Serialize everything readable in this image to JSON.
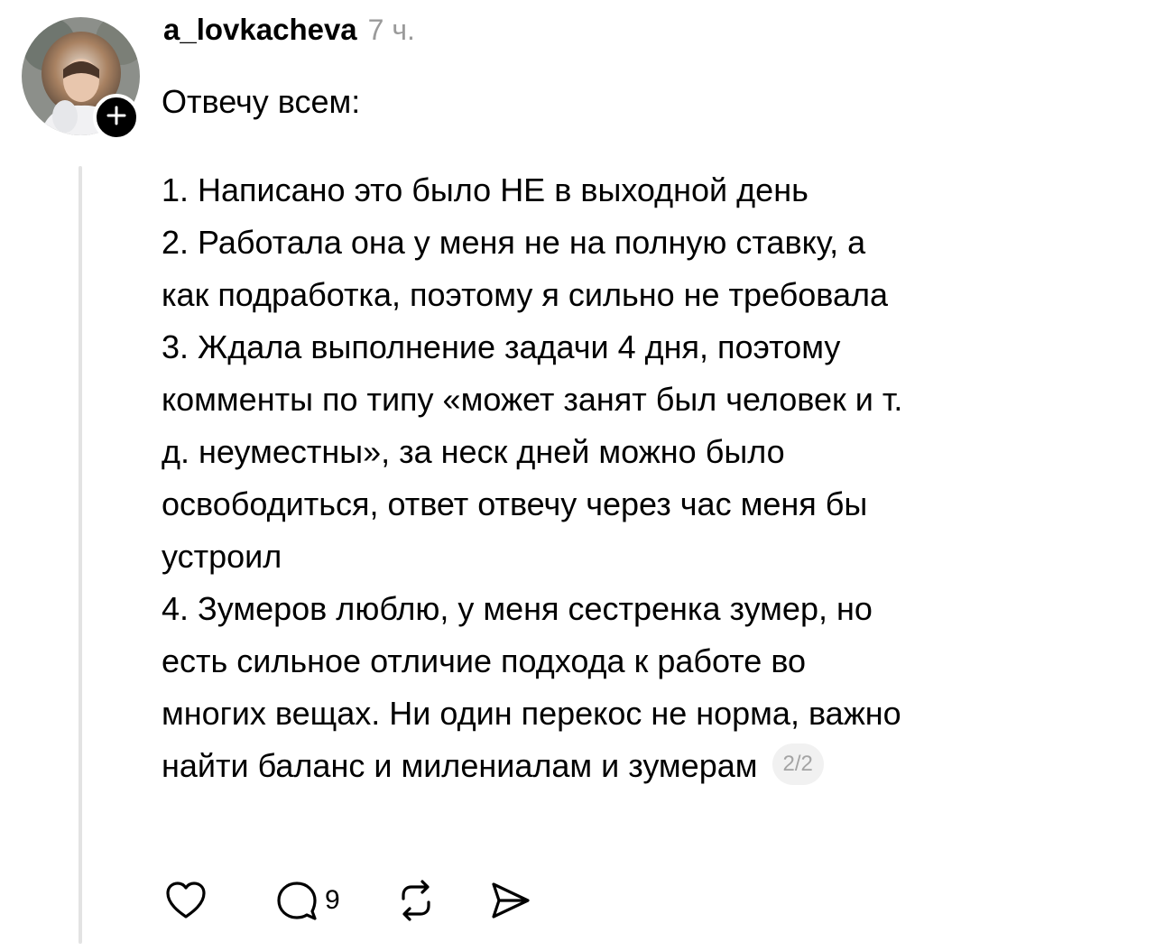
{
  "post": {
    "author": {
      "username": "a_lovkacheva",
      "avatar_icon": "avatar-photo",
      "follow_icon": "plus-icon"
    },
    "time": "7 ч.",
    "lines_intro": [
      "Отвечу всем:"
    ],
    "lines_body": [
      "1. Написано это было НЕ в выходной день",
      "2. Работала она у меня не на полную ставку, а",
      "как подработка, поэтому я сильно не требовала",
      "3. Ждала выполнение задачи 4 дня, поэтому",
      "комменты по типу «может занят был человек и т.",
      "д. неуместны», за неск дней можно было",
      "освободиться, ответ отвечу через час меня бы",
      "устроил",
      "4. Зумеров люблю, у меня сестренка зумер, но",
      "есть сильное отличие подхода к работе во",
      "многих вещах. Ни один перекос не норма, важно"
    ],
    "last_line": "найти баланс и милениалам и зумерам",
    "page_indicator": "2/2"
  },
  "actions": {
    "like_icon": "heart-icon",
    "reply_icon": "comment-icon",
    "reply_count": "9",
    "repost_icon": "repost-icon",
    "share_icon": "send-icon"
  },
  "colors": {
    "text": "#000000",
    "muted": "#9a9a9a",
    "thread_line": "#e3e3e3",
    "badge_bg": "#f1f1f1"
  }
}
